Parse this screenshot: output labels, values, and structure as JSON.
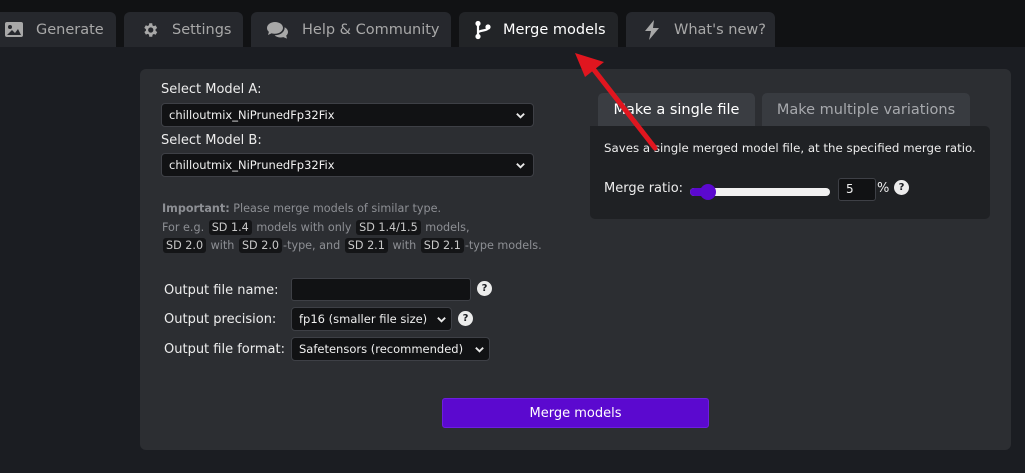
{
  "tabs": [
    {
      "label": "Generate",
      "icon": "image-icon"
    },
    {
      "label": "Settings",
      "icon": "gear-icon"
    },
    {
      "label": "Help & Community",
      "icon": "comments-icon"
    },
    {
      "label": "Merge models",
      "icon": "code-branch-icon",
      "active": true
    },
    {
      "label": "What's new?",
      "icon": "bolt-icon"
    }
  ],
  "merge": {
    "model_a_label": "Select Model A:",
    "model_a_value": "chilloutmix_NiPrunedFp32Fix",
    "model_b_label": "Select Model B:",
    "model_b_value": "chilloutmix_NiPrunedFp32Fix",
    "note": {
      "important": "Important:",
      "line1": "Please merge models of similar type.",
      "line2_a": "For e.g.",
      "tag_sd14": "SD 1.4",
      "line2_b": "models with only",
      "tag_sd1415": "SD 1.4/1.5",
      "line2_c": "models,",
      "tag_sd20": "SD 2.0",
      "line3_a": "with",
      "tag_sd20b": "SD 2.0",
      "line3_b": "-type, and",
      "tag_sd21": "SD 2.1",
      "line3_c": "with",
      "tag_sd21b": "SD 2.1",
      "line3_d": "-type models."
    },
    "output_name_label": "Output file name:",
    "output_name_value": "",
    "output_precision_label": "Output precision:",
    "output_precision_value": "fp16 (smaller file size)",
    "output_format_label": "Output file format:",
    "output_format_value": "Safetensors (recommended)",
    "help_glyph": "?",
    "merge_button": "Merge models"
  },
  "mode_tabs": {
    "single": "Make a single file",
    "multiple": "Make multiple variations"
  },
  "single": {
    "description": "Saves a single merged model file, at the specified merge ratio.",
    "ratio_label": "Merge ratio:",
    "ratio_value": "5",
    "ratio_unit": "%",
    "ratio_percent": 5
  },
  "colors": {
    "accent": "#5b09cf",
    "annotation_arrow": "#e0161f"
  }
}
